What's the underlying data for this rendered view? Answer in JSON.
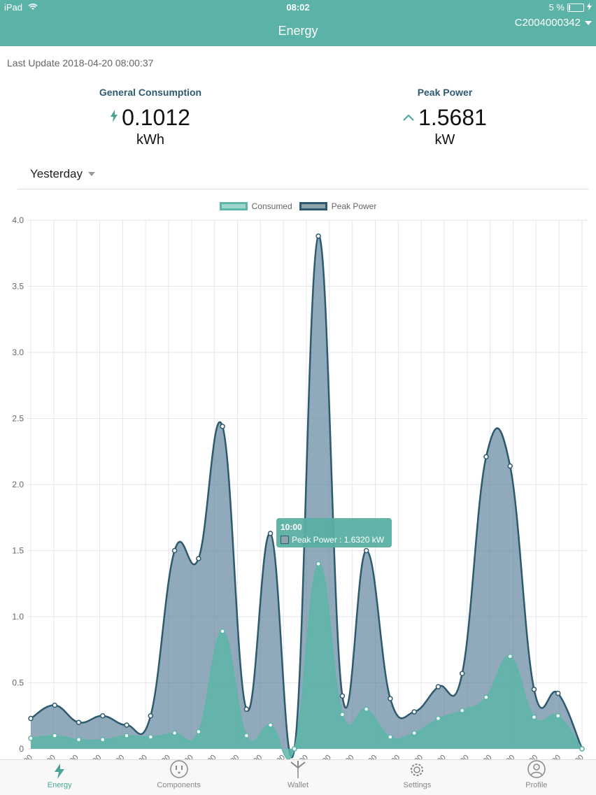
{
  "status": {
    "device": "iPad",
    "time": "08:02",
    "battery": "5 %"
  },
  "nav": {
    "title": "Energy",
    "device_id": "C2004000342"
  },
  "last_update": "Last Update 2018-04-20 08:00:37",
  "stats": {
    "consumption": {
      "label": "General Consumption",
      "value": "0.1012",
      "unit": "kWh"
    },
    "peak": {
      "label": "Peak Power",
      "value": "1.5681",
      "unit": "kW"
    }
  },
  "period": "Yesterday",
  "tooltip": {
    "title": "10:00",
    "line": "Peak Power : 1.6320 kW"
  },
  "colors": {
    "accent": "#5bb2a6",
    "consumed_fill": "#5db6a9",
    "peak_fill": "#7a9aab",
    "peak_line": "#2d5a6e"
  },
  "chart_data": {
    "type": "area",
    "series": [
      {
        "name": "Consumed",
        "values": [
          0.08,
          0.1,
          0.07,
          0.07,
          0.1,
          0.09,
          0.12,
          0.13,
          0.89,
          0.1,
          0.18,
          0.0,
          1.4,
          0.26,
          0.3,
          0.09,
          0.12,
          0.23,
          0.29,
          0.39,
          0.7,
          0.24,
          0.25,
          0.0
        ]
      },
      {
        "name": "Peak Power",
        "values": [
          0.23,
          0.33,
          0.2,
          0.25,
          0.18,
          0.25,
          1.5,
          1.44,
          2.44,
          0.3,
          1.63,
          0.0,
          3.88,
          0.4,
          1.5,
          0.38,
          0.28,
          0.47,
          0.57,
          2.21,
          2.14,
          0.45,
          0.42,
          0.0
        ]
      }
    ],
    "x_tick_labels": [
      "00",
      "00",
      "00",
      "00",
      "00",
      "00",
      "00",
      "00",
      "00",
      "00",
      "00",
      "00",
      "00",
      "00",
      "00",
      "00",
      "00",
      "00",
      "00",
      "00",
      "00",
      "00",
      "00",
      "00",
      "00"
    ],
    "yticks": [
      "0",
      "0.5",
      "1.0",
      "1.5",
      "2.0",
      "2.5",
      "3.0",
      "3.5",
      "4.0"
    ],
    "ylim": [
      0,
      4.0
    ],
    "grid": true,
    "legend": "top-center"
  },
  "tabs": [
    {
      "label": "Energy",
      "icon": "bolt-icon"
    },
    {
      "label": "Components",
      "icon": "outlet-icon"
    },
    {
      "label": "Wallet",
      "icon": "turbine-icon"
    },
    {
      "label": "Settings",
      "icon": "gear-icon"
    },
    {
      "label": "Profile",
      "icon": "user-icon"
    }
  ]
}
